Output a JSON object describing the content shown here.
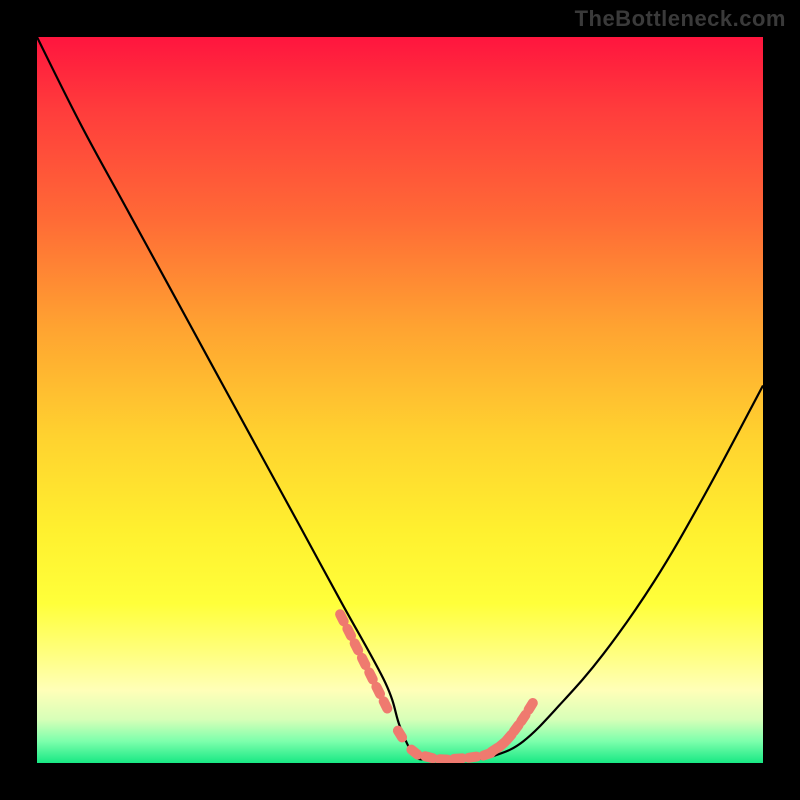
{
  "watermark": "TheBottleneck.com",
  "chart_data": {
    "type": "line",
    "title": "",
    "xlabel": "",
    "ylabel": "",
    "xlim": [
      0,
      100
    ],
    "ylim": [
      0,
      100
    ],
    "series": [
      {
        "name": "curve",
        "x": [
          0,
          6,
          12,
          18,
          24,
          30,
          36,
          42,
          48,
          50,
          52,
          54,
          57,
          60,
          63,
          67,
          72,
          78,
          85,
          92,
          100
        ],
        "values": [
          100,
          88,
          77,
          66,
          55,
          44,
          33,
          22,
          11,
          5,
          1,
          0.5,
          0.3,
          0.5,
          1,
          3,
          8,
          15,
          25,
          37,
          52
        ]
      }
    ],
    "markers": {
      "name": "highlight-dots",
      "color": "#ef7a6f",
      "x": [
        42,
        43,
        44,
        45,
        46,
        47,
        48,
        50,
        52,
        54,
        56,
        58,
        60,
        62,
        63,
        64,
        65,
        66,
        67,
        68
      ],
      "values": [
        20,
        18,
        16,
        14,
        12,
        10,
        8,
        4,
        1.5,
        0.8,
        0.5,
        0.6,
        0.8,
        1.2,
        1.8,
        2.5,
        3.5,
        4.8,
        6.2,
        7.8
      ]
    },
    "gradient_stops": [
      {
        "pct": 0,
        "color": "#ff153e"
      },
      {
        "pct": 10,
        "color": "#ff3c3c"
      },
      {
        "pct": 25,
        "color": "#ff6a36"
      },
      {
        "pct": 40,
        "color": "#ffa331"
      },
      {
        "pct": 55,
        "color": "#ffd22f"
      },
      {
        "pct": 68,
        "color": "#fff02f"
      },
      {
        "pct": 78,
        "color": "#ffff3a"
      },
      {
        "pct": 85,
        "color": "#ffff80"
      },
      {
        "pct": 90,
        "color": "#ffffb8"
      },
      {
        "pct": 94,
        "color": "#d7ffb8"
      },
      {
        "pct": 97,
        "color": "#7dffac"
      },
      {
        "pct": 100,
        "color": "#18e884"
      }
    ]
  }
}
